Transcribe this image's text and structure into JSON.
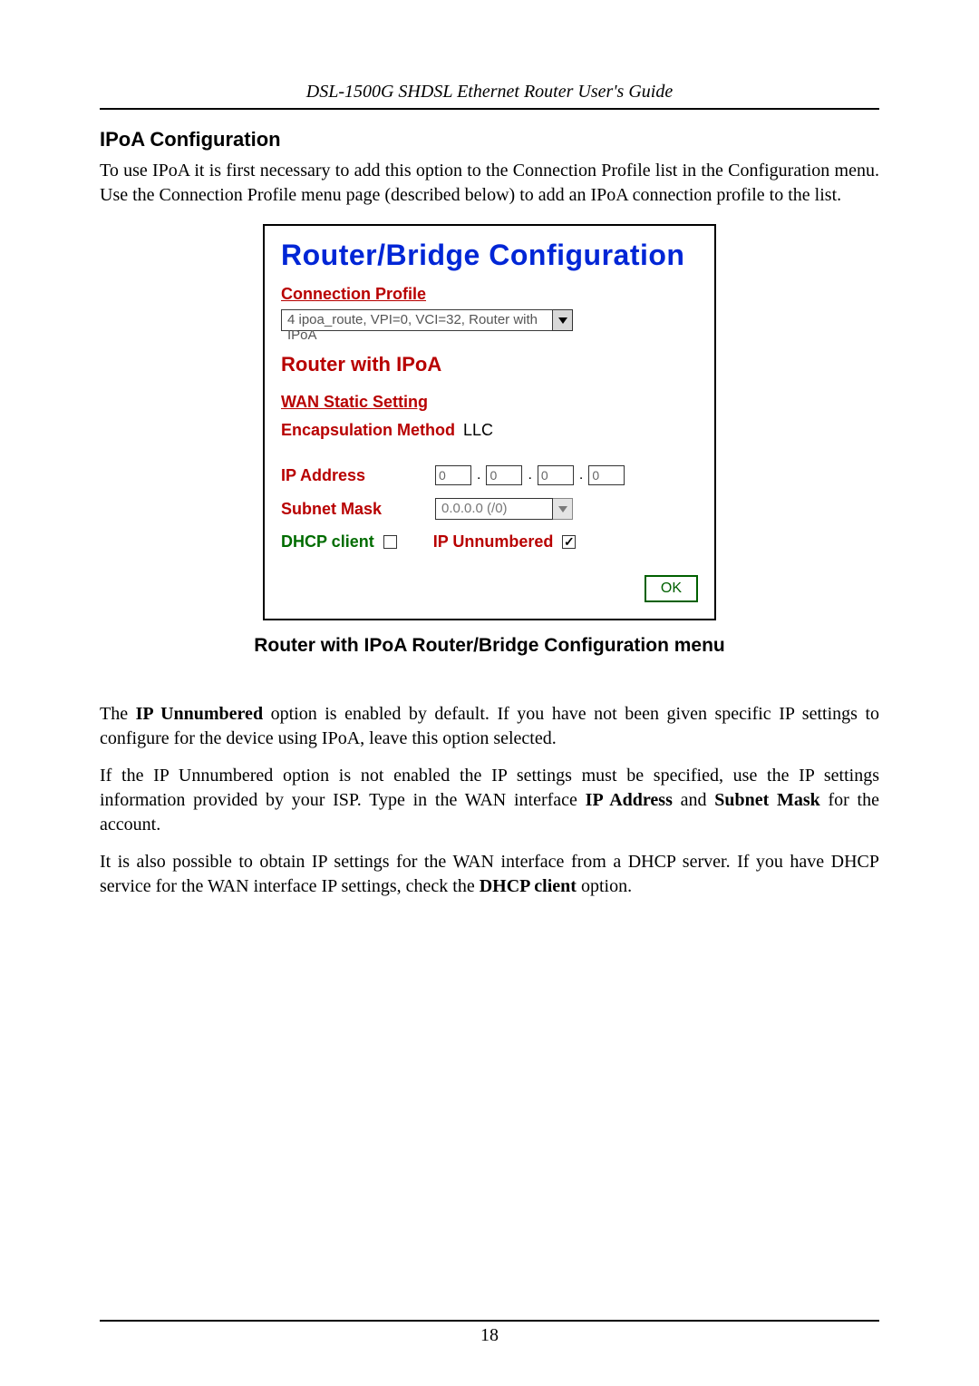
{
  "header": {
    "running": "DSL-1500G SHDSL Ethernet Router User's Guide"
  },
  "section": {
    "title": "IPoA Configuration",
    "intro": "To use IPoA it is first necessary to add this option to the Connection Profile list in the Configuration menu. Use the Connection Profile menu page (described below) to add an IPoA connection profile to the list."
  },
  "panel": {
    "title": "Router/Bridge Configuration",
    "connection_profile_label": "Connection Profile",
    "connection_profile_value": "4 ipoa_route, VPI=0, VCI=32, Router with IPoA",
    "sub_title": "Router with IPoA",
    "wan_static_label": "WAN Static Setting",
    "encapsulation_label": "Encapsulation Method",
    "encapsulation_value": "LLC",
    "ip_address_label": "IP Address",
    "ip_octets": {
      "a": "0",
      "b": "0",
      "c": "0",
      "d": "0"
    },
    "subnet_label": "Subnet Mask",
    "subnet_value": "0.0.0.0 (/0)",
    "dhcp_client_label": "DHCP client",
    "dhcp_client_checked": false,
    "ip_unnumbered_label": "IP Unnumbered",
    "ip_unnumbered_checked": true,
    "ok_label": "OK"
  },
  "caption": "Router with IPoA Router/Bridge Configuration menu",
  "paras": {
    "p1a": "The ",
    "p1b": "IP Unnumbered",
    "p1c": " option is enabled by default. If you have not been given specific IP settings to configure for the device using IPoA, leave this option selected.",
    "p2a": "If the IP Unnumbered option is not enabled the IP settings must be specified, use the IP settings information provided by your ISP. Type in the WAN interface ",
    "p2b": "IP Address",
    "p2c": " and ",
    "p2d": "Subnet Mask",
    "p2e": " for the account.",
    "p3a": "It is also possible to obtain IP settings for the WAN interface from a DHCP server. If you have DHCP service for the WAN interface IP settings, check the ",
    "p3b": "DHCP client",
    "p3c": " option."
  },
  "footer": {
    "page_number": "18"
  }
}
